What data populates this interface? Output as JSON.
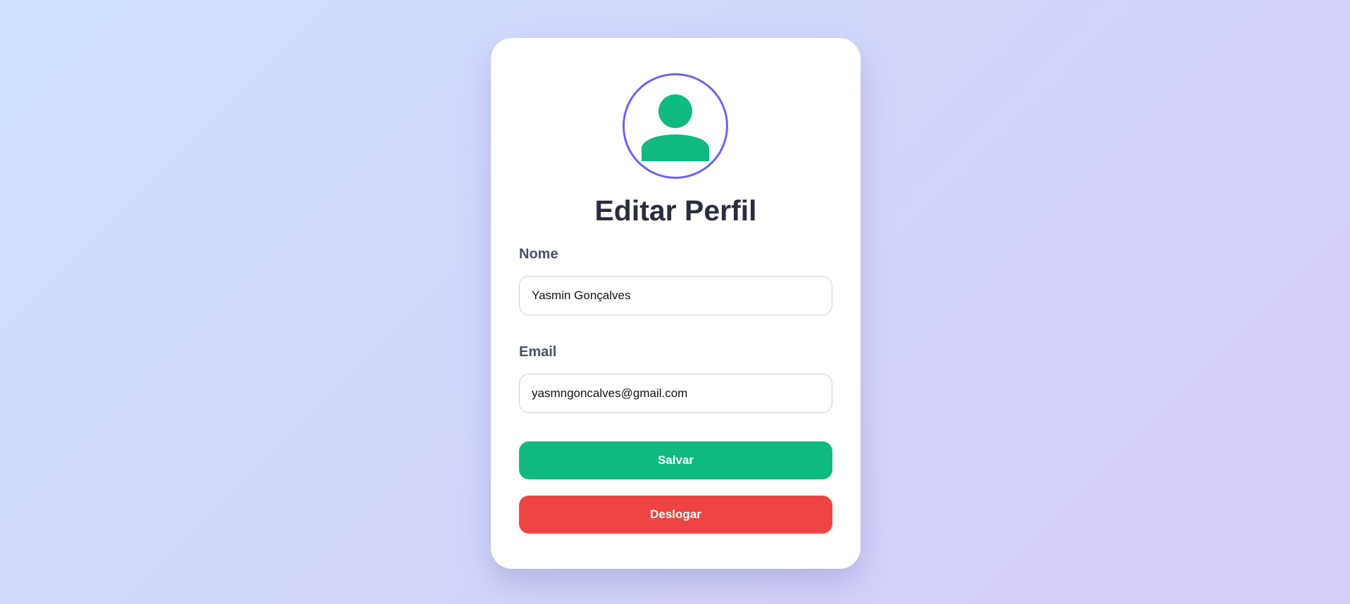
{
  "profile": {
    "title": "Editar Perfil",
    "avatar_icon": "user-icon",
    "colors": {
      "avatar_border": "#6c63ee",
      "avatar_icon": "#10b981",
      "save": "#10b981",
      "logout": "#ef4444"
    },
    "name_label": "Nome",
    "name_value": "Yasmin Gonçalves",
    "email_label": "Email",
    "email_value": "yasmngoncalves@gmail.com",
    "save_label": "Salvar",
    "logout_label": "Deslogar"
  }
}
